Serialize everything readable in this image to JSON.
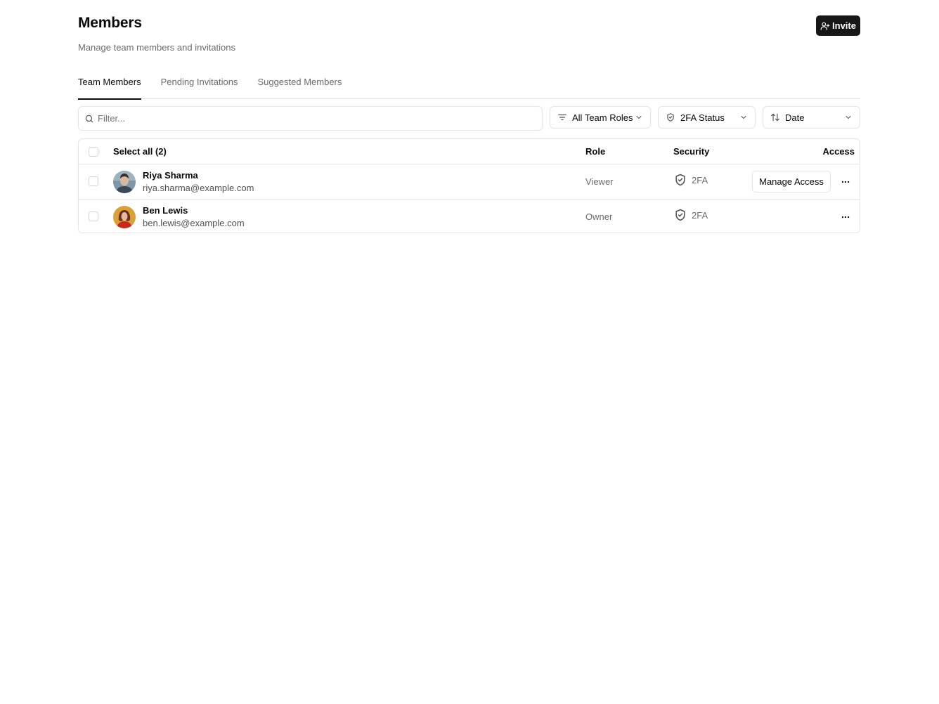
{
  "header": {
    "title": "Members",
    "subtitle": "Manage team members and invitations",
    "invite_label": "Invite"
  },
  "tabs": [
    {
      "label": "Team Members",
      "active": true
    },
    {
      "label": "Pending Invitations",
      "active": false
    },
    {
      "label": "Suggested Members",
      "active": false
    }
  ],
  "filters": {
    "search_placeholder": "Filter...",
    "roles_label": "All Team Roles",
    "twofa_label": "2FA Status",
    "sort_label": "Date"
  },
  "table": {
    "headers": {
      "select_all": "Select all (2)",
      "role": "Role",
      "security": "Security",
      "access": "Access"
    },
    "rows": [
      {
        "name": "Riya Sharma",
        "email": "riya.sharma@example.com",
        "role": "Viewer",
        "security": "2FA",
        "manage_label": "Manage Access",
        "avatar_icon": "user-photo"
      },
      {
        "name": "Ben Lewis",
        "email": "ben.lewis@example.com",
        "role": "Owner",
        "security": "2FA",
        "avatar_icon": "user-photo"
      }
    ]
  },
  "colors": {
    "primary_button": "#171717",
    "border": "#e5e5e5",
    "muted_text": "#6b6b6b"
  }
}
